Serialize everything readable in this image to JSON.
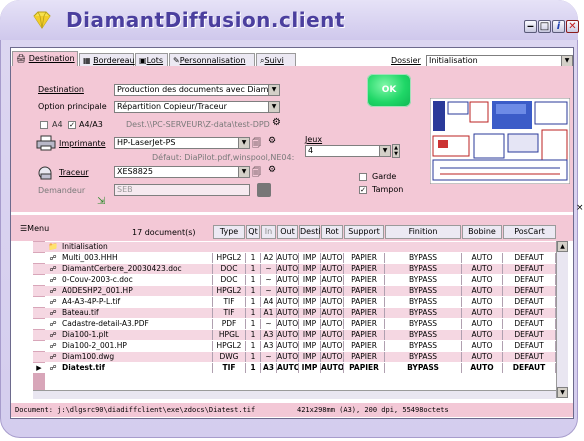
{
  "app": {
    "title": "DiamantDiffusion.client"
  },
  "tabs": [
    {
      "label": "Destination"
    },
    {
      "label": "Bordereau"
    },
    {
      "label": "Lots"
    },
    {
      "label": "Personnalisation"
    },
    {
      "label": "Suivi"
    }
  ],
  "dossier": {
    "label": "Dossier",
    "value": "Initialisation"
  },
  "form": {
    "destination_label": "Destination",
    "destination_value": "Production des documents avec DiamantD",
    "option_label": "Option principale",
    "option_value": "Répartition Copieur/Traceur",
    "a4_label": "A4",
    "a4a3_label": "A4/A3",
    "dest_path": "Dest.\\\\PC-SERVEUR\\Z-data\\test-DPD",
    "imprimante_label": "Imprimante",
    "imprimante_value": "HP-LaserJet-PS",
    "default_text": "Défaut: DiaPilot.pdf,winspool,NE04:",
    "traceur_label": "Traceur",
    "traceur_value": "XES8825",
    "demandeur_label": "Demandeur",
    "demandeur_value": "SEB",
    "jeux_label": "Jeux",
    "jeux_value": "4",
    "garde_label": "Garde",
    "tampon_label": "Tampon",
    "ok_label": "OK"
  },
  "grid": {
    "menu_label": "Menu",
    "count_label": "17 document(s)",
    "columns": [
      "Type",
      "Qt",
      "In",
      "Out",
      "Desti",
      "Rot",
      "Support",
      "Finition",
      "Bobine",
      "PosCart"
    ],
    "folder": "Initialisation",
    "rows": [
      {
        "name": "Multi_003.HHH",
        "type": "HPGL2",
        "qt": "1",
        "in": "A2",
        "out": "AUTO",
        "desti": "IMP",
        "rot": "AUTO",
        "support": "PAPIER",
        "finition": "BYPASS",
        "bobine": "AUTO",
        "poscart": "DEFAUT"
      },
      {
        "name": "DiamantCerbere_20030423.doc",
        "type": "DOC",
        "qt": "1",
        "in": "~",
        "out": "AUTO",
        "desti": "IMP",
        "rot": "AUTO",
        "support": "PAPIER",
        "finition": "BYPASS",
        "bobine": "AUTO",
        "poscart": "DEFAUT"
      },
      {
        "name": "0-Couv-2003-c.doc",
        "type": "DOC",
        "qt": "1",
        "in": "~",
        "out": "AUTO",
        "desti": "IMP",
        "rot": "AUTO",
        "support": "PAPIER",
        "finition": "BYPASS",
        "bobine": "AUTO",
        "poscart": "DEFAUT"
      },
      {
        "name": "A0DESHP2_001.HP",
        "type": "HPGL2",
        "qt": "1",
        "in": "~",
        "out": "AUTO",
        "desti": "IMP",
        "rot": "AUTO",
        "support": "PAPIER",
        "finition": "BYPASS",
        "bobine": "AUTO",
        "poscart": "DEFAUT"
      },
      {
        "name": "A4-A3-4P-P-L.tif",
        "type": "TIF",
        "qt": "1",
        "in": "A4",
        "out": "AUTO",
        "desti": "IMP",
        "rot": "AUTO",
        "support": "PAPIER",
        "finition": "BYPASS",
        "bobine": "AUTO",
        "poscart": "DEFAUT"
      },
      {
        "name": "Bateau.tif",
        "type": "TIF",
        "qt": "1",
        "in": "A1",
        "out": "AUTO",
        "desti": "IMP",
        "rot": "AUTO",
        "support": "PAPIER",
        "finition": "BYPASS",
        "bobine": "AUTO",
        "poscart": "DEFAUT"
      },
      {
        "name": "Cadastre-detail-A3.PDF",
        "type": "PDF",
        "qt": "1",
        "in": "~",
        "out": "AUTO",
        "desti": "IMP",
        "rot": "AUTO",
        "support": "PAPIER",
        "finition": "BYPASS",
        "bobine": "AUTO",
        "poscart": "DEFAUT"
      },
      {
        "name": "Dia100-1.plt",
        "type": "HPGL",
        "qt": "1",
        "in": "A3",
        "out": "AUTO",
        "desti": "IMP",
        "rot": "AUTO",
        "support": "PAPIER",
        "finition": "BYPASS",
        "bobine": "AUTO",
        "poscart": "DEFAUT"
      },
      {
        "name": "Dia100-2_001.HP",
        "type": "HPGL2",
        "qt": "1",
        "in": "A3",
        "out": "AUTO",
        "desti": "IMP",
        "rot": "AUTO",
        "support": "PAPIER",
        "finition": "BYPASS",
        "bobine": "AUTO",
        "poscart": "DEFAUT"
      },
      {
        "name": "Diam100.dwg",
        "type": "DWG",
        "qt": "1",
        "in": "~",
        "out": "AUTO",
        "desti": "IMP",
        "rot": "AUTO",
        "support": "PAPIER",
        "finition": "BYPASS",
        "bobine": "AUTO",
        "poscart": "DEFAUT"
      },
      {
        "name": "Diatest.tif",
        "type": "TIF",
        "qt": "1",
        "in": "A3",
        "out": "AUTO",
        "desti": "IMP",
        "rot": "AUTO",
        "support": "PAPIER",
        "finition": "BYPASS",
        "bobine": "AUTO",
        "poscart": "DEFAUT"
      }
    ]
  },
  "status": {
    "document": "Document: j:\\dlgsrc90\\diadiffclient\\exe\\zdocs\\Diatest.tif",
    "info": "421x298mm (A3), 200 dpi, 55498octets"
  },
  "colors": {
    "panel": "#f3c8d6",
    "frame": "#d4cdee",
    "title": "#4b3f9e",
    "ok": "#1fd767"
  }
}
